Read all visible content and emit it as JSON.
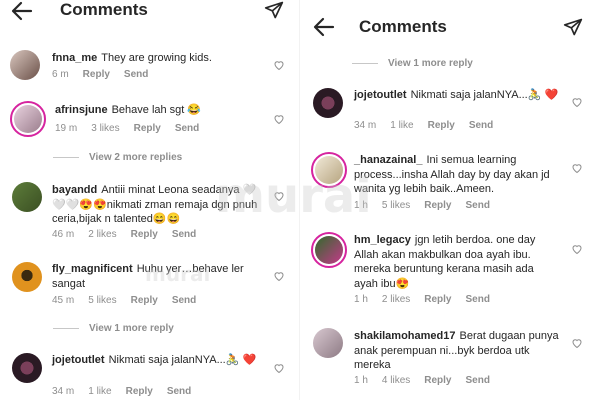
{
  "left": {
    "title": "Comments",
    "comments": [
      {
        "user": "fnna_me",
        "text": "They are growing kids.",
        "time": "6 m",
        "likes": "",
        "reply": "Reply",
        "send": "Send"
      },
      {
        "user": "afrinsjune",
        "text": "Behave lah sgt 😂",
        "time": "19 m",
        "likes": "3 likes",
        "reply": "Reply",
        "send": "Send"
      },
      {
        "user": "bayandd",
        "text": "Antiii minat Leona seadanya 🤍🤍🤍😍😍nikmati zman remaja dgn pnuh ceria,bijak n talented😄😄",
        "time": "46 m",
        "likes": "2 likes",
        "reply": "Reply",
        "send": "Send"
      },
      {
        "user": "fly_magnificent",
        "text": "Huhu yer…behave ler sangat",
        "time": "45 m",
        "likes": "5 likes",
        "reply": "Reply",
        "send": "Send"
      },
      {
        "user": "jojetoutlet",
        "text": "Nikmati saja jalanNYA...🚴 ❤️",
        "time": "34 m",
        "likes": "1 like",
        "reply": "Reply",
        "send": "Send"
      }
    ],
    "view_more_1": "View 2 more replies",
    "view_more_2": "View 1 more reply"
  },
  "right": {
    "title": "Comments",
    "view_more": "View 1 more reply",
    "comments": [
      {
        "user": "jojetoutlet",
        "text": "Nikmati saja jalanNYA...🚴 ❤️",
        "time": "34 m",
        "likes": "1 like",
        "reply": "Reply",
        "send": "Send"
      },
      {
        "user": "_hanazainal_",
        "text": "Ini semua learning process...insha Allah day by day akan jd wanita yg lebih baik..Ameen.",
        "time": "1 h",
        "likes": "5 likes",
        "reply": "Reply",
        "send": "Send"
      },
      {
        "user": "hm_legacy",
        "text": "jgn letih berdoa. one day Allah akan makbulkan doa ayah ibu. mereka beruntung kerana masih ada ayah ibu😍",
        "time": "1 h",
        "likes": "2 likes",
        "reply": "Reply",
        "send": "Send"
      },
      {
        "user": "shakilamohamed17",
        "text": "Berat dugaan punya anak perempuan ni...byk berdoa utk mereka",
        "time": "1 h",
        "likes": "4 likes",
        "reply": "Reply",
        "send": "Send"
      }
    ]
  },
  "watermark": "murai",
  "colors": {
    "muted": "#8e8e8e",
    "text": "#262626",
    "ring": "#d6249f"
  },
  "icons": [
    "back-arrow-icon",
    "send-icon",
    "heart-icon"
  ]
}
